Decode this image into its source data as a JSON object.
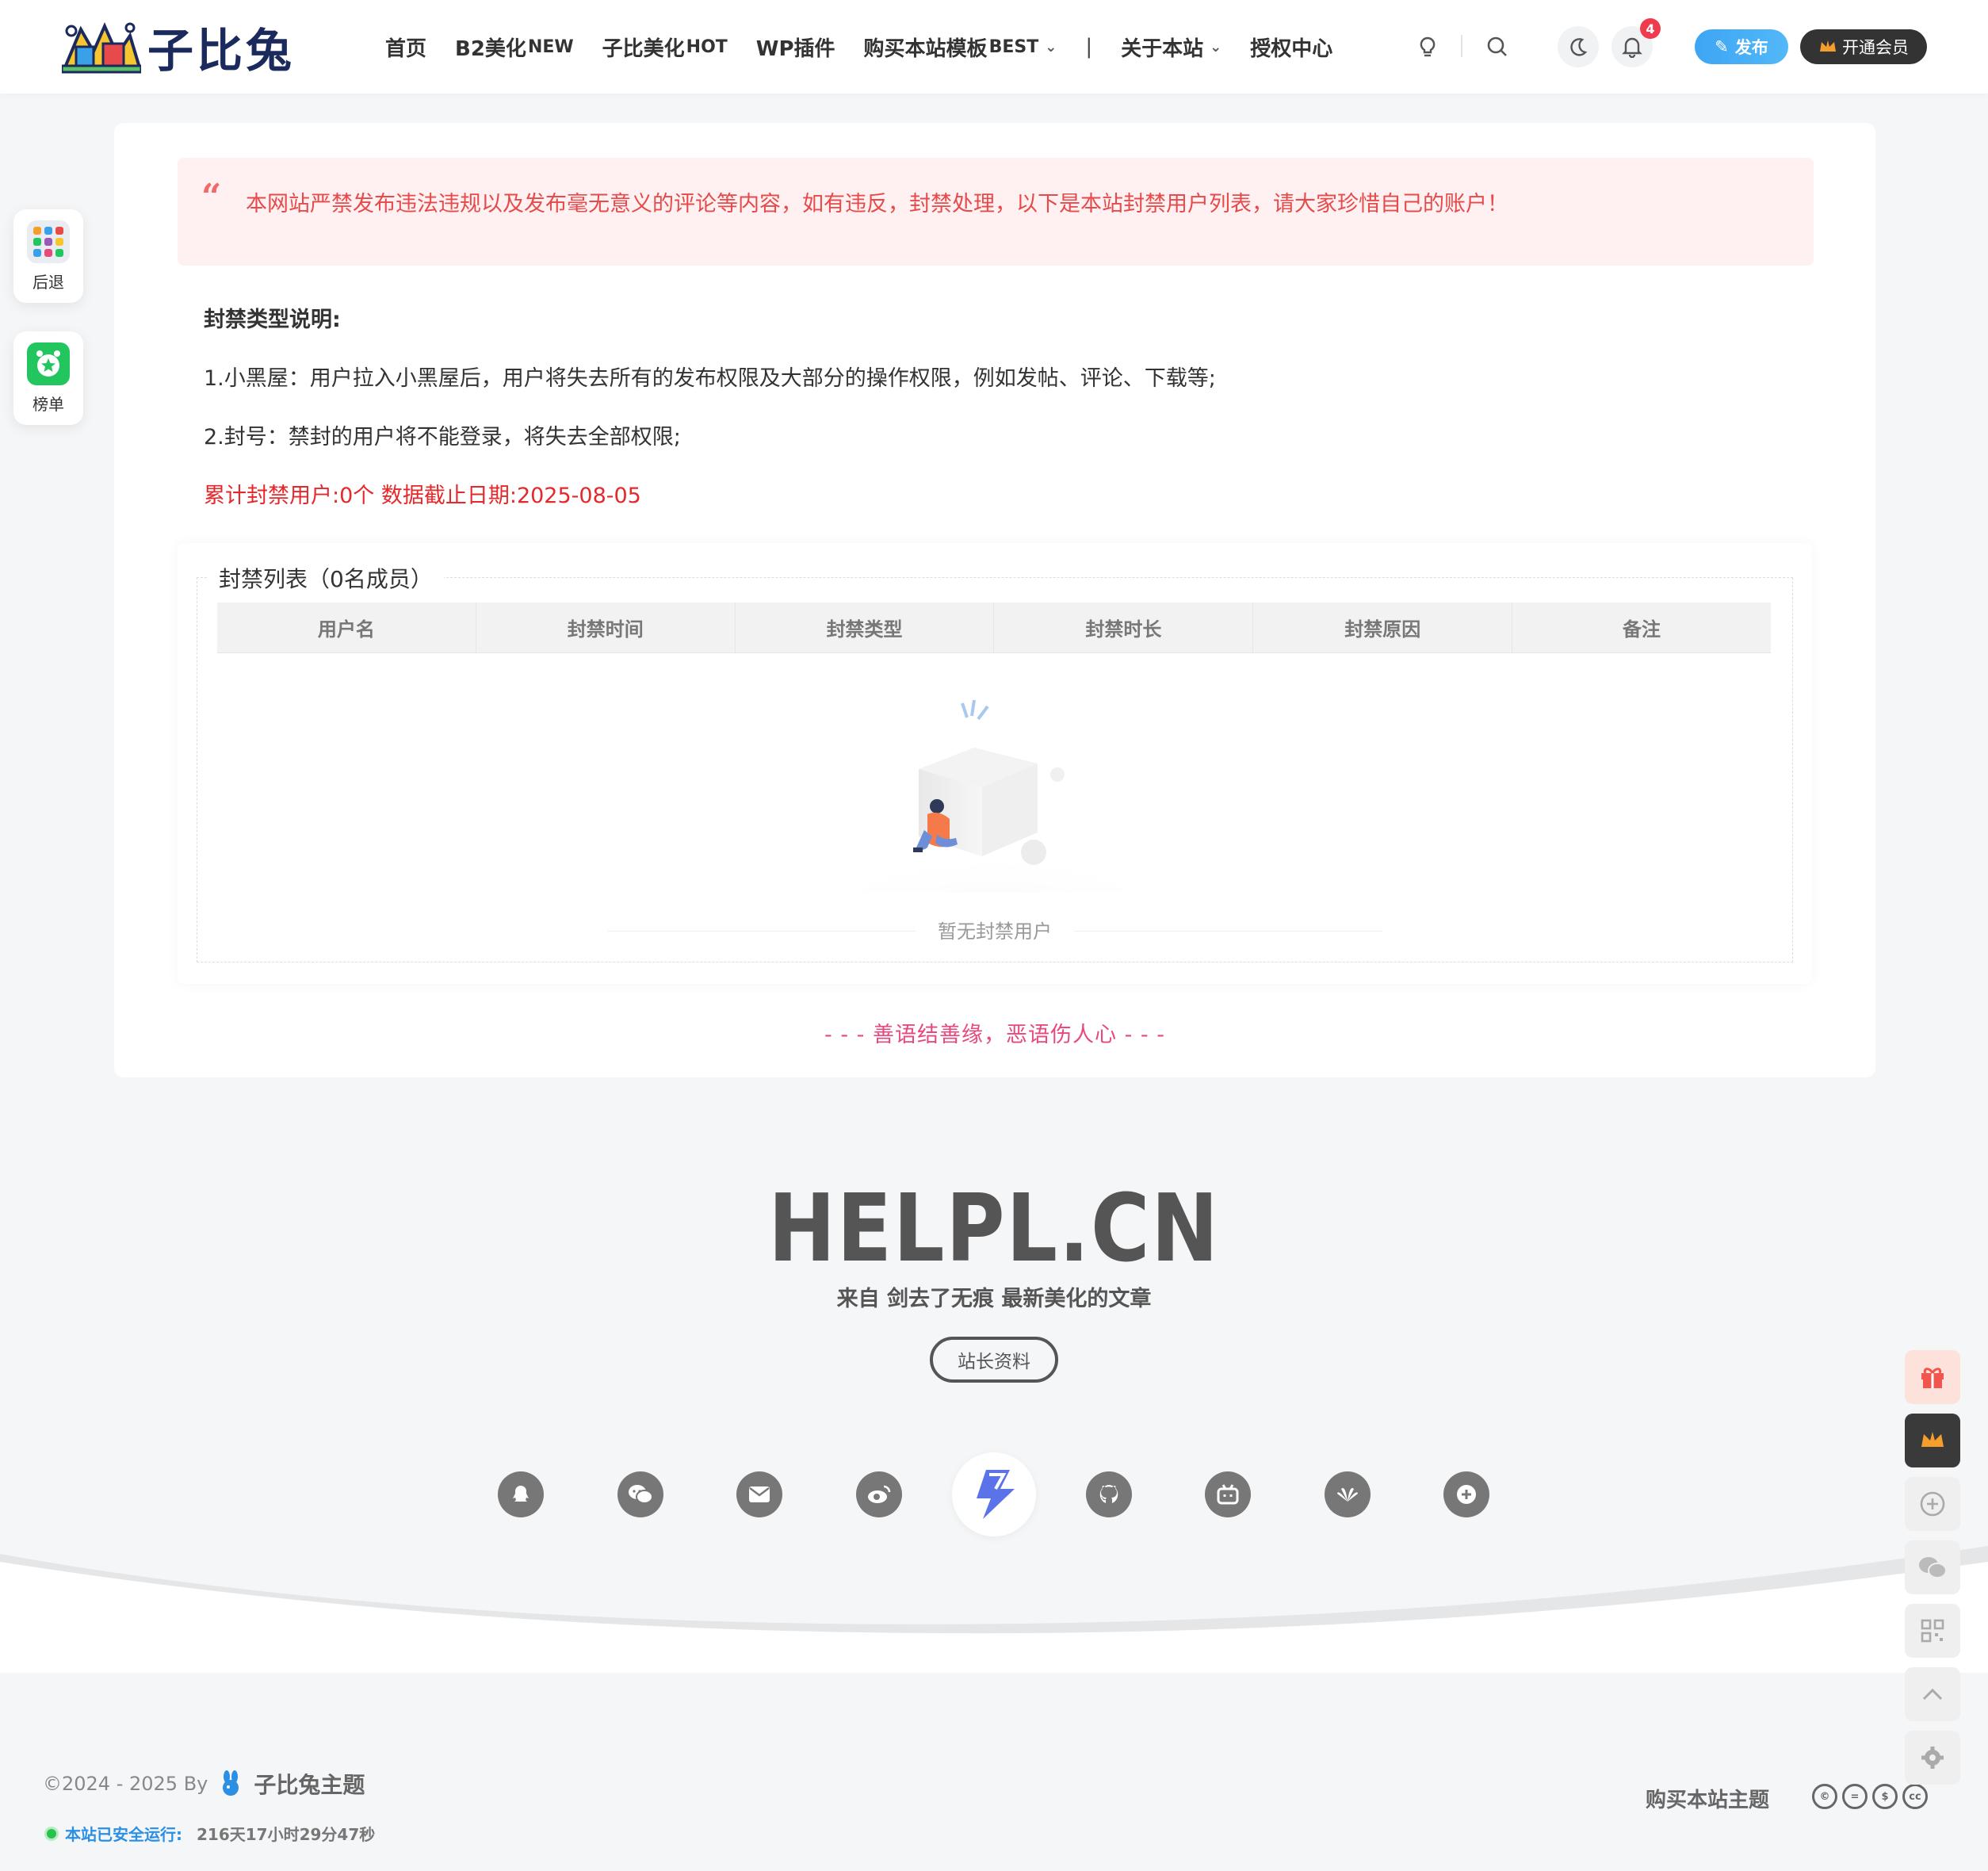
{
  "header": {
    "logo_text": "子比兔",
    "nav": [
      {
        "label": "首页"
      },
      {
        "label": "B2美化",
        "sup": "NEW"
      },
      {
        "label": "子比美化",
        "sup": "HOT"
      },
      {
        "label": "WP插件"
      },
      {
        "label": "购买本站模板",
        "sup": "BEST",
        "dropdown": true
      },
      {
        "label": "|",
        "separator": true
      },
      {
        "label": "关于本站",
        "dropdown": true
      },
      {
        "label": "授权中心"
      }
    ],
    "notification_count": "4",
    "publish_label": "发布",
    "vip_label": "开通会员",
    "accent_blue": "#3da5f4",
    "badge_red": "#f03a4d"
  },
  "left_float": {
    "back_label": "后退",
    "rank_label": "榜单"
  },
  "notice": {
    "text": "本网站严禁发布违法违规以及发布毫无意义的评论等内容，如有违反，封禁处理，以下是本站封禁用户列表，请大家珍惜自己的账户！"
  },
  "explanation": {
    "title": "封禁类型说明:",
    "line1": "1.小黑屋：用户拉入小黑屋后，用户将失去所有的发布权限及大部分的操作权限，例如发帖、评论、下载等;",
    "line2": "2.封号：禁封的用户将不能登录，将失去全部权限;",
    "summary": "累计封禁用户:0个 数据截止日期:2025-08-05"
  },
  "ban_list": {
    "legend": "封禁列表（0名成员）",
    "columns": [
      "用户名",
      "封禁时间",
      "封禁类型",
      "封禁时长",
      "封禁原因",
      "备注"
    ],
    "empty_text": "暂无封禁用户"
  },
  "motto": "- - - 善语结善缘，恶语伤人心 - - -",
  "footer": {
    "brand": "HELPL.CN",
    "subtitle": "来自 剑去了无痕 最新美化的文章",
    "owner_button": "站长资料",
    "social_icons": [
      "qq-icon",
      "wechat-icon",
      "mail-icon",
      "weibo-icon",
      "site-logo-icon",
      "github-icon",
      "bilibili-icon",
      "huawei-icon",
      "plus-circle-icon"
    ],
    "copyright": "©2024 - 2025 By",
    "theme_name": "子比兔主题",
    "runtime_label": "本站已安全运行:",
    "runtime_value": "216天17小时29分47秒",
    "buy_theme": "购买本站主题",
    "license_icons": [
      "cc-icon",
      "equals-icon",
      "nd-icon",
      "nc-icon"
    ]
  },
  "right_float": [
    "gift-icon",
    "crown-icon",
    "plus-circle-icon",
    "wechat-icon",
    "qrcode-icon",
    "arrow-up-icon",
    "gear-icon"
  ]
}
